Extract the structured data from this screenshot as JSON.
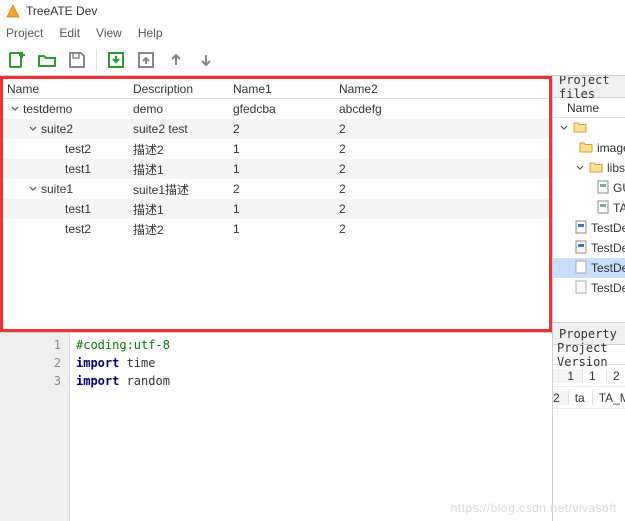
{
  "window": {
    "title": "TreeATE Dev"
  },
  "menu": {
    "project": "Project",
    "edit": "Edit",
    "view": "View",
    "help": "Help"
  },
  "toolbar": {
    "icons": [
      "new",
      "open",
      "save",
      "import",
      "export",
      "up",
      "down"
    ]
  },
  "tree": {
    "headers": {
      "name": "Name",
      "desc": "Description",
      "n1": "Name1",
      "n2": "Name2"
    },
    "rows": [
      {
        "name": "testdemo",
        "desc": "demo",
        "n1": "gfedcba",
        "n2": "abcdefg",
        "level": 1,
        "expand": true,
        "alt": false
      },
      {
        "name": "suite2",
        "desc": "suite2 test",
        "n1": "2",
        "n2": "2",
        "level": 2,
        "expand": true,
        "alt": true
      },
      {
        "name": "test2",
        "desc": "描述2",
        "n1": "1",
        "n2": "2",
        "level": 3,
        "expand": false,
        "alt": false
      },
      {
        "name": "test1",
        "desc": "描述1",
        "n1": "1",
        "n2": "2",
        "level": 3,
        "expand": false,
        "alt": true
      },
      {
        "name": "suite1",
        "desc": "suite1描述",
        "n1": "2",
        "n2": "2",
        "level": 2,
        "expand": true,
        "alt": false
      },
      {
        "name": "test1",
        "desc": "描述1",
        "n1": "1",
        "n2": "2",
        "level": 3,
        "expand": false,
        "alt": true
      },
      {
        "name": "test2",
        "desc": "描述2",
        "n1": "1",
        "n2": "2",
        "level": 3,
        "expand": false,
        "alt": false
      }
    ]
  },
  "code": {
    "gutter": [
      "1",
      "2",
      "3"
    ],
    "line1_comment": "#coding:utf-8",
    "line2_kw": "import",
    "line2_rest": " time",
    "line3_kw": "import",
    "line3_rest": " random"
  },
  "right": {
    "files_title": "Project files",
    "files_header": "Name",
    "files": [
      {
        "kind": "folder-open",
        "label": "",
        "indent": 6,
        "chev": true
      },
      {
        "kind": "folder",
        "label": "images",
        "indent": 22,
        "chev": false,
        "closed": true
      },
      {
        "kind": "folder",
        "label": "libs",
        "indent": 22,
        "chev": true
      },
      {
        "kind": "py",
        "label": "GUI_",
        "indent": 44
      },
      {
        "kind": "py",
        "label": "TA_M",
        "indent": 44
      },
      {
        "kind": "py-blue",
        "label": "TestDem",
        "indent": 22
      },
      {
        "kind": "py-blue",
        "label": "TestDem",
        "indent": 22
      },
      {
        "kind": "doc",
        "label": "TestDem",
        "indent": 22,
        "sel": true
      },
      {
        "kind": "doc",
        "label": "TestDem",
        "indent": 22
      }
    ],
    "prop_title": "Property",
    "prop_header": "Project Version",
    "prop_rows": [
      {
        "c1": "1",
        "c2": "2"
      },
      {
        "c1": "ta",
        "c2": "TA_MsgB"
      }
    ]
  },
  "watermark": "https://blog.csdn.net/vivasoft"
}
